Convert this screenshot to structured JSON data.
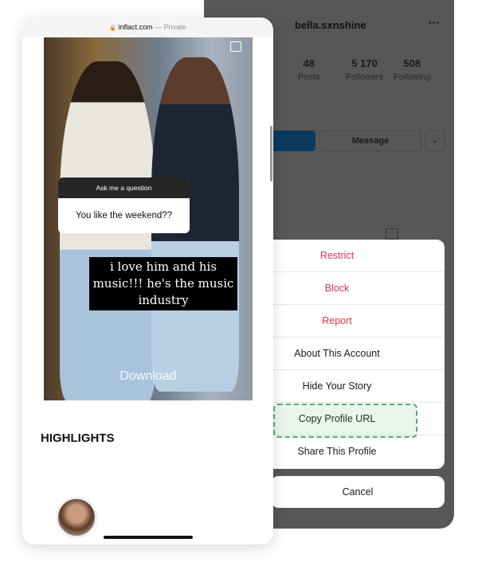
{
  "profile": {
    "username": "bella.sxnshine",
    "more": "···",
    "stats": [
      {
        "value": "48",
        "label": "Posts"
      },
      {
        "value": "5 170",
        "label": "Followers"
      },
      {
        "value": "508",
        "label": "Following"
      }
    ],
    "message_label": "Message",
    "dropdown": "⌄"
  },
  "sheet": {
    "items": [
      {
        "label": "Restrict",
        "destructive": true
      },
      {
        "label": "Block",
        "destructive": true
      },
      {
        "label": "Report",
        "destructive": true
      },
      {
        "label": "About This Account"
      },
      {
        "label": "Hide Your Story"
      },
      {
        "label": "Copy Profile URL",
        "highlighted": true
      },
      {
        "label": "Share This Profile"
      }
    ],
    "cancel": "Cancel"
  },
  "browser": {
    "lock": "🔒",
    "domain": "inflact.com",
    "sep": " — ",
    "mode": "Private"
  },
  "story": {
    "question_header": "Ask me a question",
    "question": "You like the weekend??",
    "answer": "i love him and his music!!! he's the music industry",
    "download": "Download"
  },
  "highlights": {
    "title": "HIGHLIGHTS"
  },
  "colors": {
    "destructive": "#e0344f",
    "highlight": "#4caf6e",
    "follow": "#0b3a60"
  }
}
